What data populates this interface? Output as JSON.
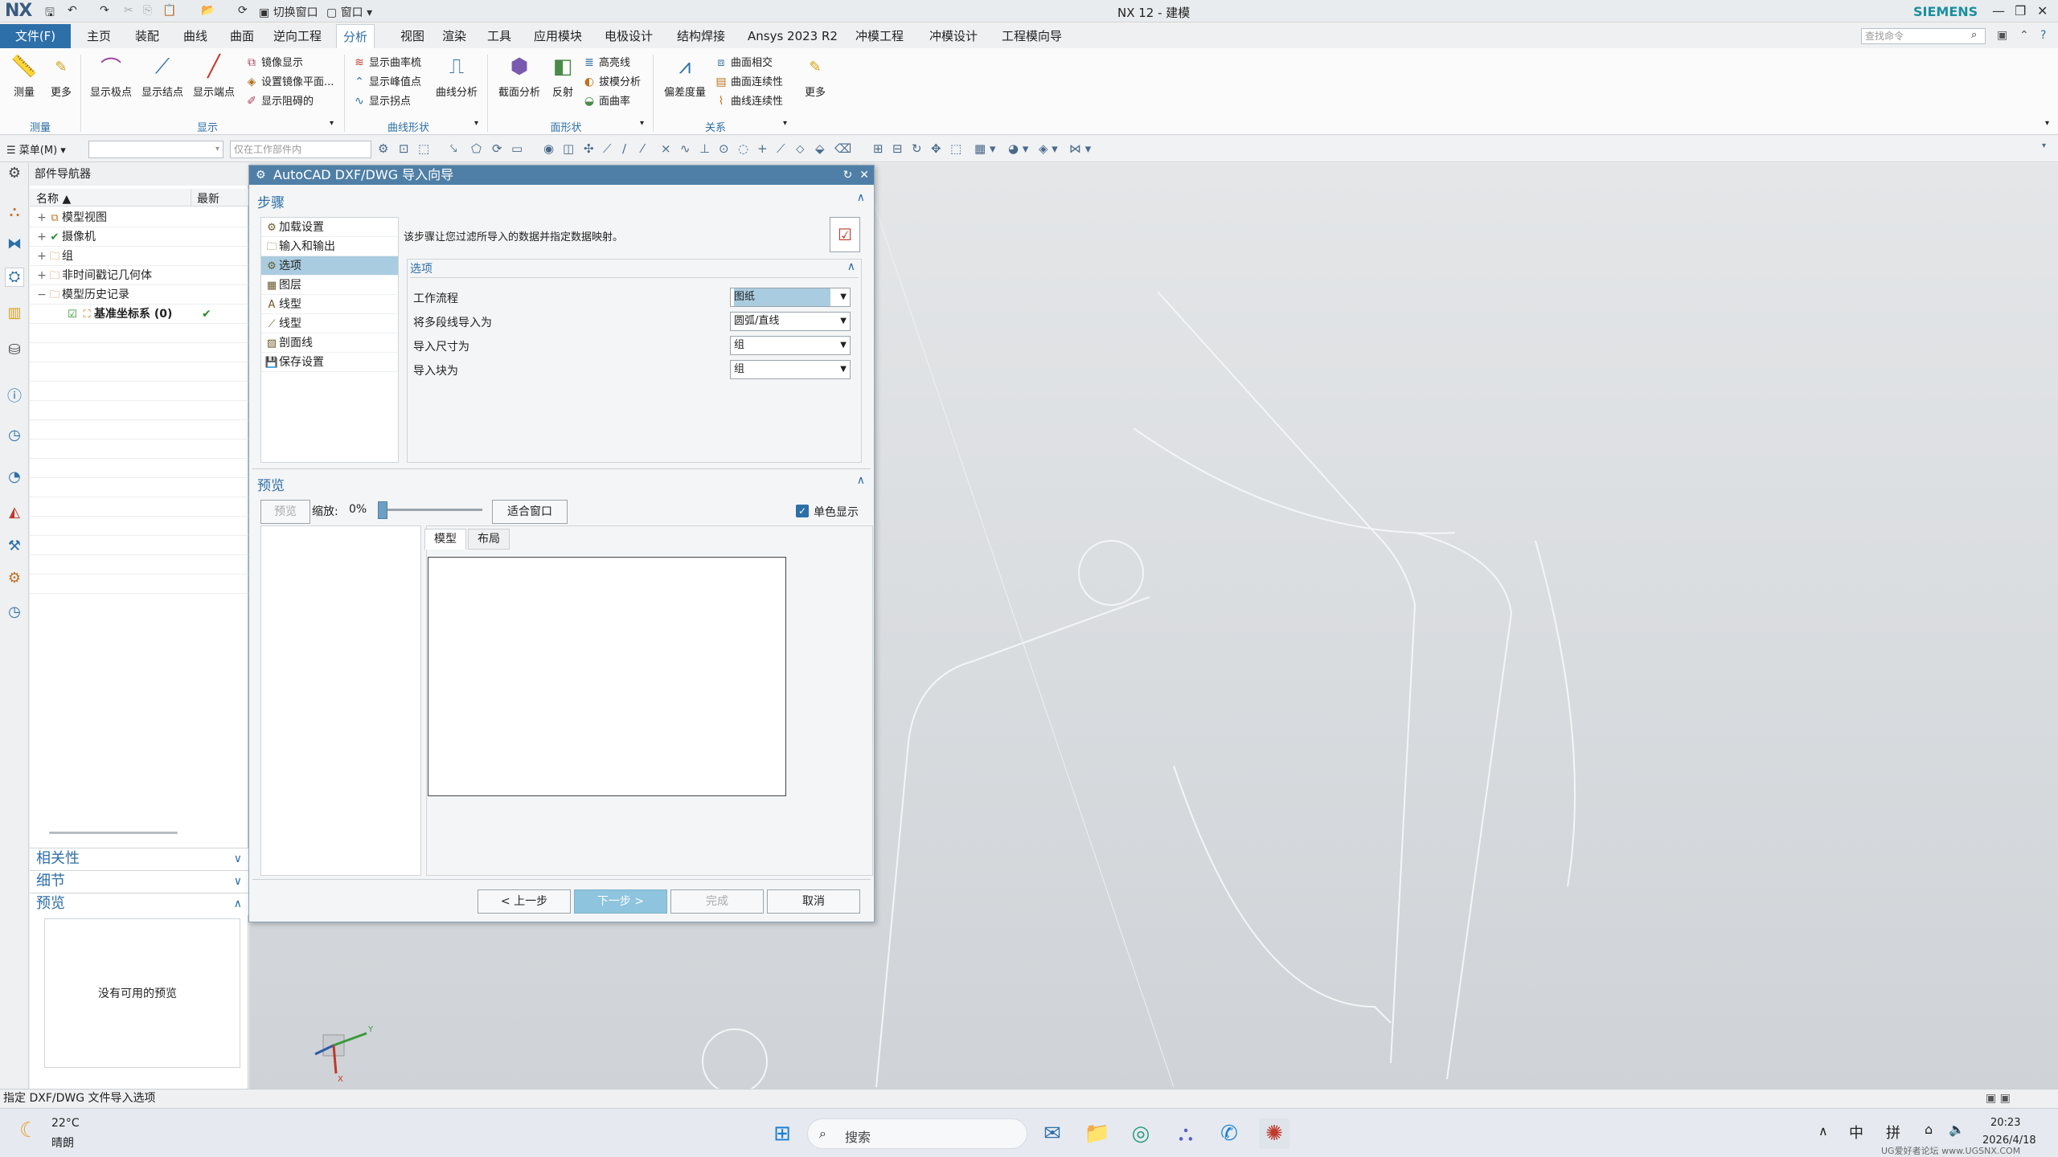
{
  "window": {
    "logo": "NX",
    "title": "NX 12 - 建模",
    "brand": "SIEMENS",
    "quick_switch": "切换窗口",
    "quick_window": "窗口"
  },
  "menu": {
    "file": "文件(F)",
    "tabs": [
      "主页",
      "装配",
      "曲线",
      "曲面",
      "逆向工程",
      "分析",
      "视图",
      "渲染",
      "工具",
      "应用模块",
      "电极设计",
      "结构焊接",
      "Ansys 2023 R2",
      "冲模工程",
      "冲模设计",
      "工程模向导"
    ],
    "active_tab": "分析",
    "search_placeholder": "查找命令"
  },
  "ribbon": {
    "measure": {
      "measure": "测量",
      "more": "更多",
      "group": "测量"
    },
    "display": {
      "show_poles": "显示极点",
      "show_knots": "显示结点",
      "show_endpoints": "显示端点",
      "mirror_display": "镜像显示",
      "set_mirror_plane": "设置镜像平面...",
      "show_damped": "显示阻碍的",
      "group": "显示"
    },
    "curve_shape": {
      "show_curvature_comb": "显示曲率梳",
      "show_peak": "显示峰值点",
      "show_inflection": "显示拐点",
      "curve_analysis": "曲线分析",
      "group": "曲线形状"
    },
    "face_shape": {
      "section_analysis": "截面分析",
      "reflection": "反射",
      "highlight_lines": "高亮线",
      "draft_analysis": "拔模分析",
      "face_curvature": "面曲率",
      "group": "面形状"
    },
    "relation": {
      "deviation_gauge": "偏差度量",
      "surface_intersect": "曲面相交",
      "surface_continuity": "曲面连续性",
      "curve_continuity": "曲线连续性",
      "more": "更多",
      "group": "关系"
    }
  },
  "toolbar": {
    "menu_label": "菜单(M)",
    "filter_placeholder": "仅在工作部件内"
  },
  "navigator": {
    "title": "部件导航器",
    "col_name": "名称",
    "col_latest": "最新",
    "rows": [
      {
        "exp": "+",
        "label": "模型视图",
        "icon": "views-icon"
      },
      {
        "exp": "+",
        "label": "摄像机",
        "icon": "camera-icon"
      },
      {
        "exp": "+",
        "label": "组",
        "icon": "folder-icon"
      },
      {
        "exp": "+",
        "label": "非时间戳记几何体",
        "icon": "folder-icon"
      },
      {
        "exp": "−",
        "label": "模型历史记录",
        "icon": "folder-icon"
      },
      {
        "exp": "",
        "label": "基准坐标系 (0)",
        "icon": "csys-icon",
        "latest": "✔"
      }
    ],
    "sections": {
      "dependency": "相关性",
      "details": "细节",
      "preview": "预览"
    },
    "no_preview": "没有可用的预览"
  },
  "dialog": {
    "title": "AutoCAD DXF/DWG 导入向导",
    "steps_header": "步骤",
    "steps": [
      "加载设置",
      "输入和输出",
      "选项",
      "图层",
      "线型",
      "线型",
      "剖面线",
      "保存设置"
    ],
    "selected_step": "选项",
    "description": "该步骤让您过滤所导入的数据并指定数据映射。",
    "options_header": "选项",
    "options": [
      {
        "label": "工作流程",
        "value": "图纸"
      },
      {
        "label": "将多段线导入为",
        "value": "圆弧/直线"
      },
      {
        "label": "导入尺寸为",
        "value": "组"
      },
      {
        "label": "导入块为",
        "value": "组"
      }
    ],
    "preview_header": "预览",
    "preview_button": "预览",
    "zoom_label": "缩放:",
    "zoom_value": "0%",
    "zoom_fraction": 0.0,
    "fit_window": "适合窗口",
    "monochrome": "单色显示",
    "monochrome_checked": true,
    "tabs": [
      "模型",
      "布局"
    ],
    "buttons": {
      "back": "< 上一步",
      "next": "下一步 >",
      "finish": "完成",
      "cancel": "取消"
    }
  },
  "status": {
    "text": "指定 DXF/DWG 文件导入选项"
  },
  "taskbar": {
    "temp": "22°C",
    "weather": "晴朗",
    "search": "搜索",
    "ime1": "中",
    "ime2": "拼",
    "time": "20:23",
    "date": "2026/4/18",
    "watermark": "UG爱好者论坛 www.UGSNX.COM"
  },
  "colors": {
    "accent": "#2d6fa8",
    "dialog_title": "#4f7fa6",
    "selection": "#a9cce0"
  }
}
